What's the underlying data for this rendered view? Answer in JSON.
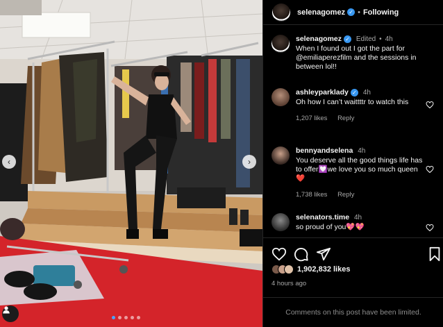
{
  "post": {
    "username": "selenagomez",
    "follow_status": "Following",
    "separator": "•"
  },
  "caption": {
    "username": "selenagomez",
    "edited": "Edited",
    "time": "4h",
    "text": "When I found out I got the part for @emiliaperezfilm and the sessions in between lol!!"
  },
  "comments": [
    {
      "username": "ashleyparklady",
      "verified": true,
      "time": "4h",
      "text": "Oh how I can’t waittttr to watch this",
      "likes": "1,207 likes",
      "reply": "Reply"
    },
    {
      "username": "bennyandselena",
      "verified": false,
      "time": "4h",
      "text": "You deserve all the good things life has to offer💟we love you so much queen❤️",
      "likes": "1,738 likes",
      "reply": "Reply"
    },
    {
      "username": "selenators.time",
      "verified": false,
      "time": "4h",
      "text": "so proud of you💖💖",
      "likes": "",
      "reply": ""
    }
  ],
  "stats": {
    "likes": "1,902,832 likes",
    "time_ago": "4 hours ago"
  },
  "footer": {
    "limited_text": "Comments on this post have been limited."
  },
  "carousel": {
    "prev_glyph": "‹",
    "next_glyph": "›",
    "slide_count": 5,
    "active_index": 0
  },
  "colors": {
    "verified_blue": "#3897f0",
    "muted_text": "#a8a8a8",
    "heart_red": "#ed4956"
  },
  "icons": [
    "verified-icon",
    "heart-icon",
    "comment-icon",
    "share-icon",
    "bookmark-icon",
    "user-tag-icon",
    "chevron-left-icon",
    "chevron-right-icon"
  ]
}
